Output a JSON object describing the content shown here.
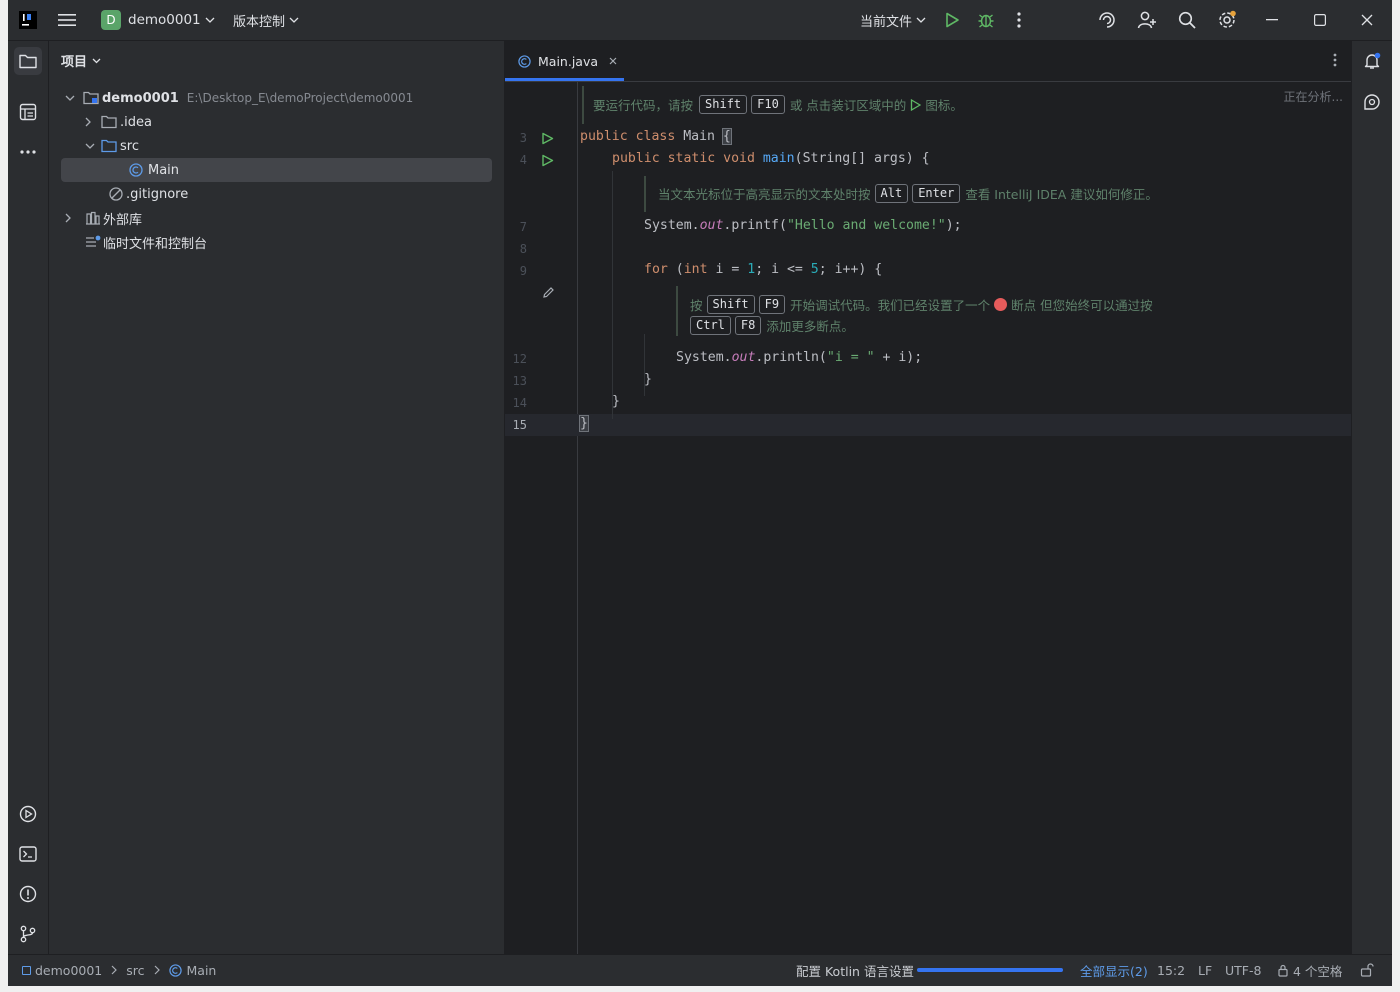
{
  "titlebar": {
    "project_badge": "D",
    "project_name": "demo0001",
    "vcs_label": "版本控制",
    "run_config": "当前文件"
  },
  "project_panel": {
    "title": "项目",
    "tree": [
      {
        "label": "demo0001",
        "path": "E:\\Desktop_E\\demoProject\\demo0001"
      },
      {
        "label": ".idea"
      },
      {
        "label": "src"
      },
      {
        "label": "Main"
      },
      {
        "label": ".gitignore"
      },
      {
        "label": "外部库"
      },
      {
        "label": "临时文件和控制台"
      }
    ]
  },
  "editor": {
    "tab_label": "Main.java",
    "analyzing": "正在分析...",
    "hint1": {
      "pre": "要运行代码，请按",
      "k1": "Shift",
      "k2": "F10",
      "post": "或 点击装订区域中的",
      "post2": "图标。"
    },
    "hint2": {
      "pre": "当文本光标位于高亮显示的文本处时按",
      "k1": "Alt",
      "k2": "Enter",
      "post": "查看 IntelliJ IDEA 建议如何修正。"
    },
    "hint3": {
      "pre": "按",
      "k1": "Shift",
      "k2": "F9",
      "mid": "开始调试代码。我们已经设置了一个",
      "post": "断点 但您始终可以通过按",
      "k3": "Ctrl",
      "k4": "F8",
      "end": "添加更多断点。"
    },
    "line_numbers": [
      "3",
      "4",
      "7",
      "8",
      "9",
      "12",
      "13",
      "14",
      "15"
    ],
    "code": {
      "l3_a": "public class ",
      "l3_b": "Main ",
      "l3_c": "{",
      "l4_a": "public static void ",
      "l4_b": "main",
      "l4_c": "(String[] args) {",
      "l7_a": "System.",
      "l7_b": "out",
      "l7_c": ".printf(",
      "l7_d": "\"Hello and welcome!\"",
      "l7_e": ");",
      "l9_a": "for ",
      "l9_b": "(",
      "l9_c": "int ",
      "l9_d": "i = ",
      "l9_e": "1",
      "l9_f": "; i <= ",
      "l9_g": "5",
      "l9_h": "; i++) {",
      "l12_a": "System.",
      "l12_b": "out",
      "l12_c": ".println(",
      "l12_d": "\"i = \"",
      "l12_e": " + i);",
      "l13": "}",
      "l14": "}",
      "l15": "}"
    }
  },
  "statusbar": {
    "breadcrumb": [
      "demo0001",
      "src",
      "Main"
    ],
    "kotlin_task": "配置 Kotlin 语言设置",
    "progress": 1.0,
    "show_all": "全部显示(2)",
    "position": "15:2",
    "line_sep": "LF",
    "encoding": "UTF-8",
    "indent": "4 个空格"
  },
  "colors": {
    "accent": "#3574f0",
    "run_green": "#5fb865",
    "bg": "#1e1f22",
    "panel": "#2b2d30",
    "selection": "#43454a"
  }
}
